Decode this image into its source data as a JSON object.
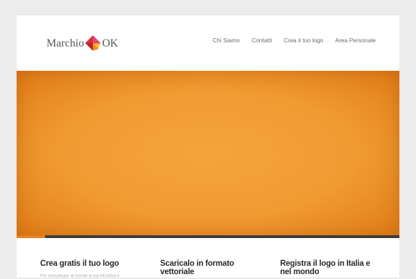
{
  "brand": {
    "name_left": "Marchio",
    "name_right": "OK",
    "logo_icon": "folded-diamond-icon",
    "colors": {
      "red": "#d9322f",
      "pink": "#e0457b",
      "orange": "#f28c28",
      "yellow": "#f7c331"
    }
  },
  "nav": {
    "items": [
      {
        "label": "Chi Siamo"
      },
      {
        "label": "Contatti"
      },
      {
        "label": "Crea il tuo logo"
      },
      {
        "label": "Area Personale"
      }
    ]
  },
  "hero": {
    "accent": "#f09a32",
    "slider_progress": 0.075
  },
  "features": [
    {
      "title": "Crea gratis il tuo logo",
      "text": "Per comunicare al mondo la tua iniziativa o"
    },
    {
      "title": "Scaricalo in formato vettoriale",
      "text": ""
    },
    {
      "title": "Registra il logo in Italia e nel mondo",
      "text": ""
    }
  ]
}
